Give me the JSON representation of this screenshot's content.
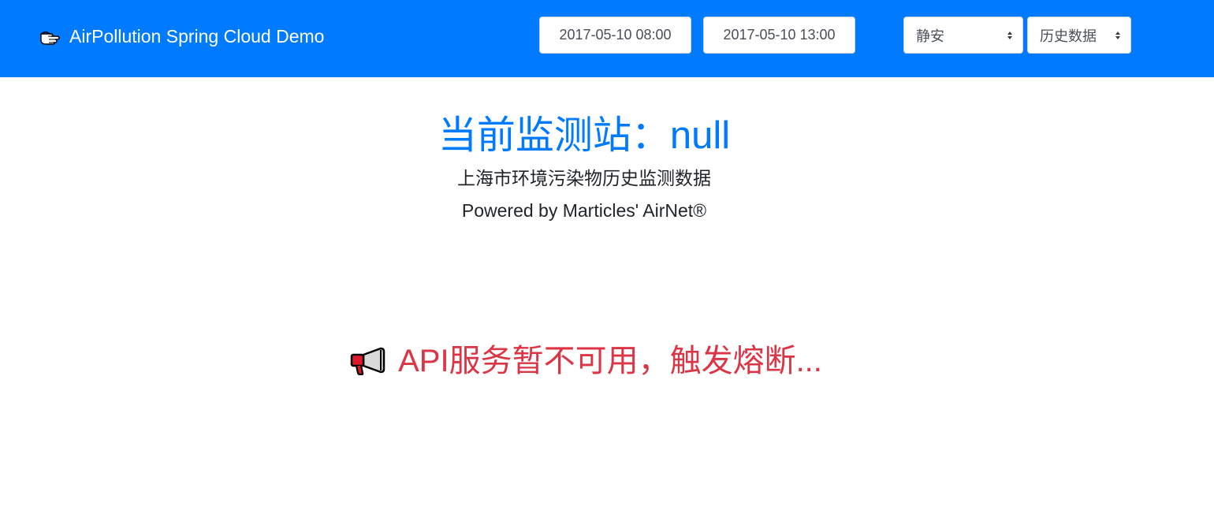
{
  "navbar": {
    "brand_icon": "pointing-hand-icon",
    "brand_text": "AirPollution Spring Cloud Demo",
    "start_time": "2017-05-10 08:00",
    "end_time": "2017-05-10 13:00",
    "station_select": "静安",
    "mode_select": "历史数据",
    "background_color": "#007bff"
  },
  "main": {
    "title": "当前监测站：null",
    "subtitle": "上海市环境污染物历史监测数据",
    "powered_by": "Powered by Marticles' AirNet®",
    "alert_icon": "megaphone-icon",
    "alert_message": "API服务暂不可用，触发熔断...",
    "title_color": "#007bff",
    "alert_color": "#dc3545"
  }
}
